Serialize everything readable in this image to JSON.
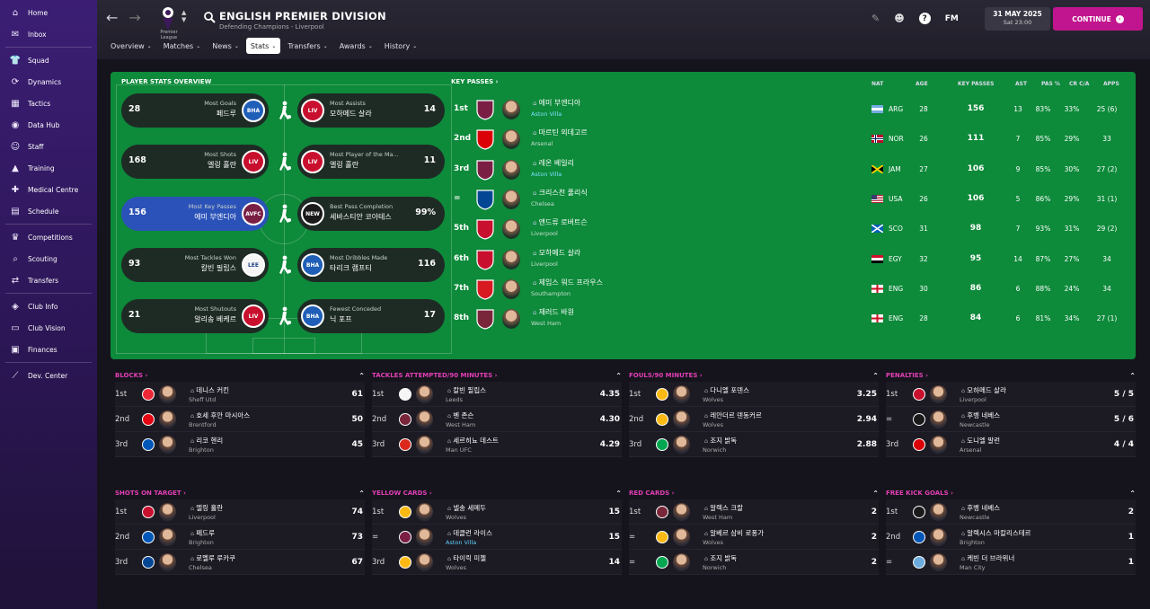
{
  "sidebar": {
    "items": [
      {
        "label": "Home",
        "icon": "home-icon",
        "glyph": "⌂"
      },
      {
        "label": "Inbox",
        "icon": "inbox-icon",
        "glyph": "✉"
      },
      {
        "label": "Squad",
        "icon": "shirt-icon",
        "glyph": "👕"
      },
      {
        "label": "Dynamics",
        "icon": "dynamics-icon",
        "glyph": "⟳"
      },
      {
        "label": "Tactics",
        "icon": "tactics-icon",
        "glyph": "▦"
      },
      {
        "label": "Data Hub",
        "icon": "data-hub-icon",
        "glyph": "◉"
      },
      {
        "label": "Staff",
        "icon": "staff-icon",
        "glyph": "☺"
      },
      {
        "label": "Training",
        "icon": "training-icon",
        "glyph": "▲"
      },
      {
        "label": "Medical Centre",
        "icon": "medical-icon",
        "glyph": "✚"
      },
      {
        "label": "Schedule",
        "icon": "calendar-icon",
        "glyph": "▤"
      },
      {
        "label": "Competitions",
        "icon": "trophy-icon",
        "glyph": "♛"
      },
      {
        "label": "Scouting",
        "icon": "scouting-icon",
        "glyph": "⌕"
      },
      {
        "label": "Transfers",
        "icon": "transfers-icon",
        "glyph": "⇄"
      },
      {
        "label": "Club Info",
        "icon": "club-info-icon",
        "glyph": "◈"
      },
      {
        "label": "Club Vision",
        "icon": "club-vision-icon",
        "glyph": "▭"
      },
      {
        "label": "Finances",
        "icon": "finances-icon",
        "glyph": "▣"
      },
      {
        "label": "Dev. Center",
        "icon": "dev-center-icon",
        "glyph": "⟋"
      }
    ]
  },
  "header": {
    "league_badge_text": "Premier League",
    "title": "ENGLISH PREMIER DIVISION",
    "subtitle": "Defending Champions - Liverpool",
    "tabs": [
      {
        "label": "Overview",
        "active": false
      },
      {
        "label": "Matches",
        "active": false
      },
      {
        "label": "News",
        "active": false
      },
      {
        "label": "Stats",
        "active": true
      },
      {
        "label": "Transfers",
        "active": false
      },
      {
        "label": "Awards",
        "active": false
      },
      {
        "label": "History",
        "active": false
      }
    ],
    "date": "31 MAY 2025",
    "time": "Sat 23:00",
    "fm_label": "FM",
    "continue_label": "CONTINUE"
  },
  "colors": {
    "accent": "#c1158f",
    "green_panel": "#0d8a3a",
    "sidebar": "#3b1e74",
    "highlight": "#2b52b8",
    "section_title": "#e23fb5"
  },
  "overview": {
    "title": "PLAYER STATS OVERVIEW",
    "rows": [
      {
        "left": {
          "value": "28",
          "label": "Most Goals",
          "name": "페드루",
          "club": "BHA",
          "color": "#1f5fb8",
          "highlight": false
        },
        "right": {
          "value": "14",
          "label": "Most Assists",
          "name": "모하메드 살라",
          "club": "LIV",
          "color": "#c8102e"
        }
      },
      {
        "left": {
          "value": "168",
          "label": "Most Shots",
          "name": "엘링 홀란",
          "club": "LIV",
          "color": "#c8102e",
          "highlight": false
        },
        "right": {
          "value": "11",
          "label": "Most Player of the Ma...",
          "name": "엘링 홀란",
          "club": "LIV",
          "color": "#c8102e"
        }
      },
      {
        "left": {
          "value": "156",
          "label": "Most Key Passes",
          "name": "에미 부엔디아",
          "club": "AVFC",
          "color": "#7a1e44",
          "highlight": true
        },
        "right": {
          "value": "99%",
          "label": "Best Pass Completion",
          "name": "세바스티안 코아테스",
          "club": "NEW",
          "color": "#1a1a1a"
        }
      },
      {
        "left": {
          "value": "93",
          "label": "Most Tackles Won",
          "name": "칼빈 필립스",
          "club": "LEE",
          "color": "#f5f5f5",
          "highlight": false
        },
        "right": {
          "value": "116",
          "label": "Most Dribbles Made",
          "name": "타리크 램프티",
          "club": "BHA",
          "color": "#1f5fb8"
        }
      },
      {
        "left": {
          "value": "21",
          "label": "Most Shutouts",
          "name": "알리송 베케르",
          "club": "LIV",
          "color": "#c8102e",
          "highlight": false
        },
        "right": {
          "value": "17",
          "label": "Fewest Conceded",
          "name": "닉 포프",
          "club": "BHA",
          "color": "#1f5fb8"
        }
      }
    ]
  },
  "key_passes": {
    "title": "KEY PASSES",
    "headers": {
      "nat": "NAT",
      "age": "AGE",
      "kp": "KEY PASSES",
      "ast": "AST",
      "pas": "PAS %",
      "crca": "CR C/A",
      "apps": "APPS"
    },
    "rows": [
      {
        "pos": "1st",
        "name": "에미 부엔디아",
        "club": "Aston Villa",
        "link": true,
        "nat": "ARG",
        "flag": "arg",
        "age": "28",
        "kp": "156",
        "ast": "13",
        "pas": "83%",
        "crca": "33%",
        "apps": "25 (6)",
        "crest": "#7a1e44"
      },
      {
        "pos": "2nd",
        "name": "마르틴 외데고르",
        "club": "Arsenal",
        "link": false,
        "nat": "NOR",
        "flag": "nor",
        "age": "26",
        "kp": "111",
        "ast": "7",
        "pas": "85%",
        "crca": "29%",
        "apps": "33",
        "crest": "#db0007"
      },
      {
        "pos": "3rd",
        "name": "레온 베일리",
        "club": "Aston Villa",
        "link": true,
        "nat": "JAM",
        "flag": "jam",
        "age": "27",
        "kp": "106",
        "ast": "9",
        "pas": "85%",
        "crca": "30%",
        "apps": "27 (2)",
        "crest": "#7a1e44"
      },
      {
        "pos": "=",
        "name": "크리스천 풀리식",
        "club": "Chelsea",
        "link": false,
        "nat": "USA",
        "flag": "usa",
        "age": "26",
        "kp": "106",
        "ast": "5",
        "pas": "86%",
        "crca": "29%",
        "apps": "31 (1)",
        "crest": "#034694"
      },
      {
        "pos": "5th",
        "name": "앤드류 로버트슨",
        "club": "Liverpool",
        "link": false,
        "nat": "SCO",
        "flag": "sco",
        "age": "31",
        "kp": "98",
        "ast": "7",
        "pas": "93%",
        "crca": "31%",
        "apps": "29 (2)",
        "crest": "#c8102e"
      },
      {
        "pos": "6th",
        "name": "모하메드 살라",
        "club": "Liverpool",
        "link": false,
        "nat": "EGY",
        "flag": "egy",
        "age": "32",
        "kp": "95",
        "ast": "14",
        "pas": "87%",
        "crca": "27%",
        "apps": "34",
        "crest": "#c8102e"
      },
      {
        "pos": "7th",
        "name": "제임스 워드 프라우스",
        "club": "Southampton",
        "link": false,
        "nat": "ENG",
        "flag": "eng",
        "age": "30",
        "kp": "86",
        "ast": "6",
        "pas": "88%",
        "crca": "24%",
        "apps": "34",
        "crest": "#d71920"
      },
      {
        "pos": "8th",
        "name": "재러드 바원",
        "club": "West Ham",
        "link": false,
        "nat": "ENG",
        "flag": "eng",
        "age": "28",
        "kp": "84",
        "ast": "6",
        "pas": "81%",
        "crca": "34%",
        "apps": "27 (1)",
        "crest": "#7a263a"
      }
    ]
  },
  "panels": [
    {
      "title": "BLOCKS",
      "rows": [
        {
          "pos": "1st",
          "name": "데니스 커킨",
          "club": "Sheff Utd",
          "link": false,
          "value": "61",
          "crest": "#ee2737"
        },
        {
          "pos": "2nd",
          "name": "호세 후안 마시아스",
          "club": "Brentford",
          "link": false,
          "value": "50",
          "crest": "#e30613"
        },
        {
          "pos": "3rd",
          "name": "리코 헨리",
          "club": "Brighton",
          "link": false,
          "value": "45",
          "crest": "#0057b8"
        }
      ]
    },
    {
      "title": "TACKLES ATTEMPTED/90 MINUTES",
      "rows": [
        {
          "pos": "1st",
          "name": "칼빈 필립스",
          "club": "Leeds",
          "link": false,
          "value": "4.35",
          "crest": "#f5f5f5"
        },
        {
          "pos": "2nd",
          "name": "벤 존슨",
          "club": "West Ham",
          "link": false,
          "value": "4.30",
          "crest": "#7a263a"
        },
        {
          "pos": "3rd",
          "name": "세르히뇨 데스트",
          "club": "Man UFC",
          "link": false,
          "value": "4.29",
          "crest": "#da291c"
        }
      ]
    },
    {
      "title": "FOULS/90 MINUTES",
      "rows": [
        {
          "pos": "1st",
          "name": "다니엘 포덴스",
          "club": "Wolves",
          "link": false,
          "value": "3.25",
          "crest": "#fdb913"
        },
        {
          "pos": "2nd",
          "name": "레안더르 덴동커르",
          "club": "Wolves",
          "link": false,
          "value": "2.94",
          "crest": "#fdb913"
        },
        {
          "pos": "3rd",
          "name": "조지 밝독",
          "club": "Norwich",
          "link": false,
          "value": "2.88",
          "crest": "#00a650"
        }
      ]
    },
    {
      "title": "PENALTIES",
      "rows": [
        {
          "pos": "1st",
          "name": "모하메드 살라",
          "club": "Liverpool",
          "link": false,
          "value": "5 / 5",
          "crest": "#c8102e"
        },
        {
          "pos": "=",
          "name": "후벵 네베스",
          "club": "Newcastle",
          "link": false,
          "value": "5 / 6",
          "crest": "#1a1a1a"
        },
        {
          "pos": "3rd",
          "name": "도니엘 말런",
          "club": "Arsenal",
          "link": false,
          "value": "4 / 4",
          "crest": "#db0007"
        }
      ]
    },
    {
      "title": "SHOTS ON TARGET",
      "rows": [
        {
          "pos": "1st",
          "name": "엘링 홀란",
          "club": "Liverpool",
          "link": false,
          "value": "74",
          "crest": "#c8102e"
        },
        {
          "pos": "2nd",
          "name": "페드루",
          "club": "Brighton",
          "link": false,
          "value": "73",
          "crest": "#0057b8"
        },
        {
          "pos": "3rd",
          "name": "로멜루 루카쿠",
          "club": "Chelsea",
          "link": false,
          "value": "67",
          "crest": "#034694"
        }
      ]
    },
    {
      "title": "YELLOW CARDS",
      "rows": [
        {
          "pos": "1st",
          "name": "넬송 세메두",
          "club": "Wolves",
          "link": false,
          "value": "15",
          "crest": "#fdb913"
        },
        {
          "pos": "=",
          "name": "데클런 라이스",
          "club": "Aston Villa",
          "link": true,
          "value": "15",
          "crest": "#7a1e44"
        },
        {
          "pos": "3rd",
          "name": "타이릭 미첼",
          "club": "Wolves",
          "link": false,
          "value": "14",
          "crest": "#fdb913"
        }
      ]
    },
    {
      "title": "RED CARDS",
      "rows": [
        {
          "pos": "1st",
          "name": "알렉스 크랄",
          "club": "West Ham",
          "link": false,
          "value": "2",
          "crest": "#7a263a"
        },
        {
          "pos": "=",
          "name": "알베르 삼비 로퐁가",
          "club": "Wolves",
          "link": false,
          "value": "2",
          "crest": "#fdb913"
        },
        {
          "pos": "=",
          "name": "조지 밝독",
          "club": "Norwich",
          "link": false,
          "value": "2",
          "crest": "#00a650"
        }
      ]
    },
    {
      "title": "FREE KICK GOALS",
      "rows": [
        {
          "pos": "1st",
          "name": "후벵 네베스",
          "club": "Newcastle",
          "link": false,
          "value": "2",
          "crest": "#1a1a1a"
        },
        {
          "pos": "2nd",
          "name": "알렉시스 마칼리스테르",
          "club": "Brighton",
          "link": false,
          "value": "1",
          "crest": "#0057b8"
        },
        {
          "pos": "=",
          "name": "케빈 더 브라위너",
          "club": "Man City",
          "link": false,
          "value": "1",
          "crest": "#6cabdd"
        }
      ]
    }
  ]
}
